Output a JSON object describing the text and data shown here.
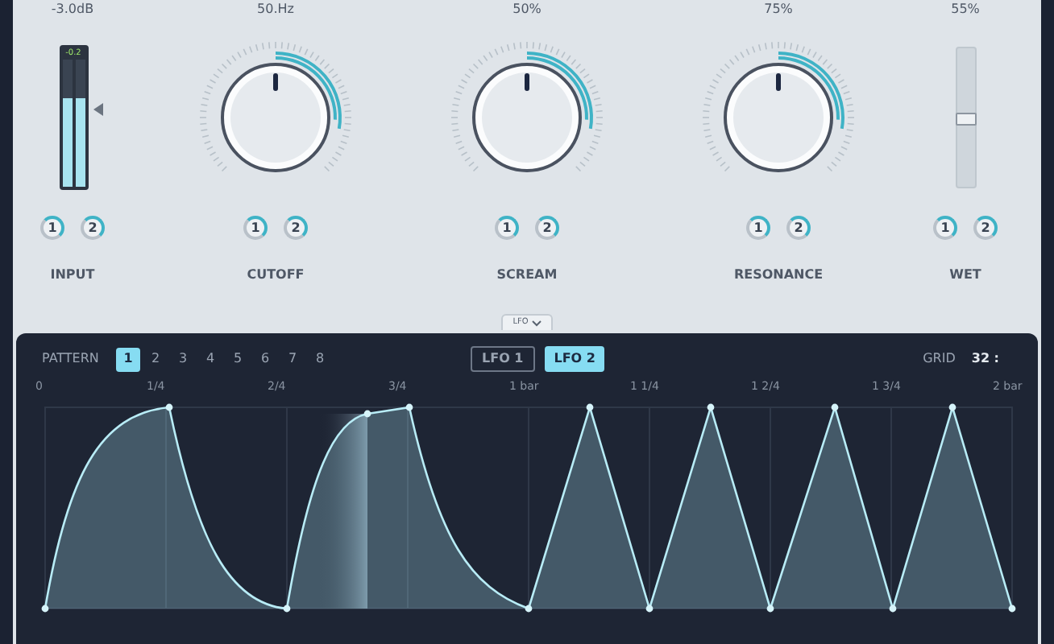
{
  "input": {
    "value": "-3.0dB",
    "peak": "-0.2",
    "level": 0.7,
    "label": "INPUT",
    "mods": [
      {
        "label": "1"
      },
      {
        "label": "2"
      }
    ]
  },
  "knobs": [
    {
      "value": "50.Hz",
      "label": "CUTOFF",
      "level": 0.5,
      "mods": [
        {
          "label": "1"
        },
        {
          "label": "2"
        }
      ]
    },
    {
      "value": "50%",
      "label": "SCREAM",
      "level": 0.5,
      "mods": [
        {
          "label": "1"
        },
        {
          "label": "2"
        }
      ]
    },
    {
      "value": "75%",
      "label": "RESONANCE",
      "level": 0.5,
      "mods": [
        {
          "label": "1"
        },
        {
          "label": "2"
        }
      ]
    }
  ],
  "wet": {
    "value": "55%",
    "label": "WET",
    "level": 0.5,
    "mods": [
      {
        "label": "1"
      },
      {
        "label": "2"
      }
    ]
  },
  "lfo_tab": {
    "label": "LFO"
  },
  "pattern": {
    "label": "PATTERN",
    "items": [
      {
        "label": "1",
        "selected": true
      },
      {
        "label": "2",
        "selected": false
      },
      {
        "label": "3",
        "selected": false
      },
      {
        "label": "4",
        "selected": false
      },
      {
        "label": "5",
        "selected": false
      },
      {
        "label": "6",
        "selected": false
      },
      {
        "label": "7",
        "selected": false
      },
      {
        "label": "8",
        "selected": false
      }
    ]
  },
  "lfo_tabs": [
    {
      "label": "LFO 1",
      "selected": false
    },
    {
      "label": "LFO 2",
      "selected": true
    }
  ],
  "grid": {
    "label": "GRID",
    "value": "32 :"
  },
  "time_labels": [
    "0",
    "1/4",
    "2/4",
    "3/4",
    "1 bar",
    "1 1/4",
    "1 2/4",
    "1 3/4",
    "2 bar"
  ]
}
